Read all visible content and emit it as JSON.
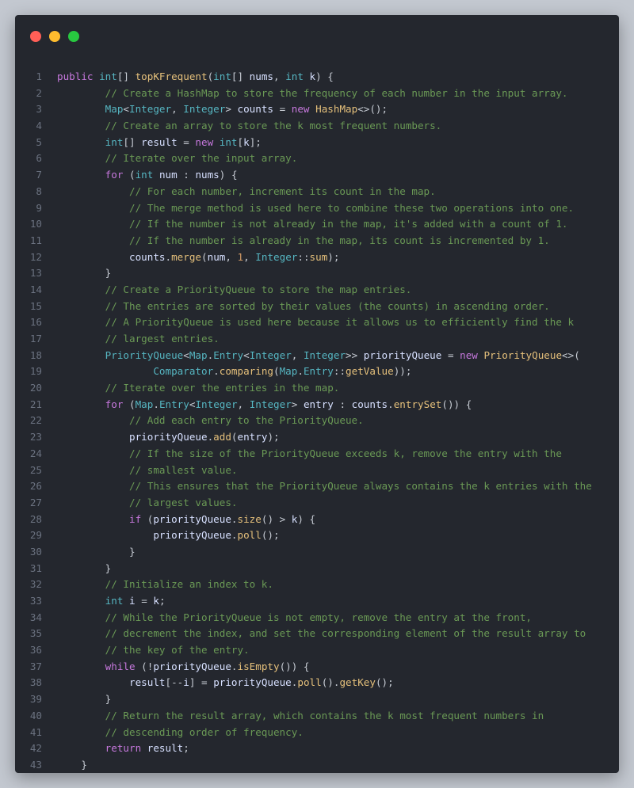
{
  "window": {
    "controls": [
      {
        "name": "close-dot",
        "color": "#ff5f57"
      },
      {
        "name": "minimize-dot",
        "color": "#febc2e"
      },
      {
        "name": "maximize-dot",
        "color": "#28c840"
      }
    ]
  },
  "editor": {
    "language": "java",
    "lines": [
      {
        "n": "1",
        "indent": 0,
        "tokens": [
          [
            "k",
            "public "
          ],
          [
            "ty",
            "int"
          ],
          [
            "p",
            "[] "
          ],
          [
            "f",
            "topKFrequent"
          ],
          [
            "p",
            "("
          ],
          [
            "ty",
            "int"
          ],
          [
            "p",
            "[] "
          ],
          [
            "v",
            "nums"
          ],
          [
            "p",
            ", "
          ],
          [
            "ty",
            "int"
          ],
          [
            "p",
            " "
          ],
          [
            "v",
            "k"
          ],
          [
            "p",
            ") {"
          ]
        ]
      },
      {
        "n": "2",
        "indent": 8,
        "tokens": [
          [
            "c",
            "// Create a HashMap to store the frequency of each number in the input array."
          ]
        ]
      },
      {
        "n": "3",
        "indent": 8,
        "tokens": [
          [
            "ty",
            "Map"
          ],
          [
            "p",
            "<"
          ],
          [
            "ty",
            "Integer"
          ],
          [
            "p",
            ", "
          ],
          [
            "ty",
            "Integer"
          ],
          [
            "p",
            "> "
          ],
          [
            "v",
            "counts"
          ],
          [
            "p",
            " = "
          ],
          [
            "k",
            "new "
          ],
          [
            "f",
            "HashMap"
          ],
          [
            "p",
            "<>();"
          ]
        ]
      },
      {
        "n": "4",
        "indent": 8,
        "tokens": [
          [
            "c",
            "// Create an array to store the k most frequent numbers."
          ]
        ]
      },
      {
        "n": "5",
        "indent": 8,
        "tokens": [
          [
            "ty",
            "int"
          ],
          [
            "p",
            "[] "
          ],
          [
            "v",
            "result"
          ],
          [
            "p",
            " = "
          ],
          [
            "k",
            "new "
          ],
          [
            "ty",
            "int"
          ],
          [
            "p",
            "["
          ],
          [
            "v",
            "k"
          ],
          [
            "p",
            "];"
          ]
        ]
      },
      {
        "n": "6",
        "indent": 8,
        "tokens": [
          [
            "c",
            "// Iterate over the input array."
          ]
        ]
      },
      {
        "n": "7",
        "indent": 8,
        "tokens": [
          [
            "k",
            "for"
          ],
          [
            "p",
            " ("
          ],
          [
            "ty",
            "int"
          ],
          [
            "p",
            " "
          ],
          [
            "v",
            "num"
          ],
          [
            "p",
            " : "
          ],
          [
            "v",
            "nums"
          ],
          [
            "p",
            ") {"
          ]
        ]
      },
      {
        "n": "8",
        "indent": 12,
        "tokens": [
          [
            "c",
            "// For each number, increment its count in the map."
          ]
        ]
      },
      {
        "n": "9",
        "indent": 12,
        "tokens": [
          [
            "c",
            "// The merge method is used here to combine these two operations into one."
          ]
        ]
      },
      {
        "n": "10",
        "indent": 12,
        "tokens": [
          [
            "c",
            "// If the number is not already in the map, it's added with a count of 1."
          ]
        ]
      },
      {
        "n": "11",
        "indent": 12,
        "tokens": [
          [
            "c",
            "// If the number is already in the map, its count is incremented by 1."
          ]
        ]
      },
      {
        "n": "12",
        "indent": 12,
        "tokens": [
          [
            "v",
            "counts"
          ],
          [
            "p",
            "."
          ],
          [
            "f",
            "merge"
          ],
          [
            "p",
            "("
          ],
          [
            "v",
            "num"
          ],
          [
            "p",
            ", "
          ],
          [
            "n",
            "1"
          ],
          [
            "p",
            ", "
          ],
          [
            "ty",
            "Integer"
          ],
          [
            "p",
            "::"
          ],
          [
            "f",
            "sum"
          ],
          [
            "p",
            ");"
          ]
        ]
      },
      {
        "n": "13",
        "indent": 8,
        "tokens": [
          [
            "p",
            "}"
          ]
        ]
      },
      {
        "n": "14",
        "indent": 8,
        "tokens": [
          [
            "c",
            "// Create a PriorityQueue to store the map entries."
          ]
        ]
      },
      {
        "n": "15",
        "indent": 8,
        "tokens": [
          [
            "c",
            "// The entries are sorted by their values (the counts) in ascending order."
          ]
        ]
      },
      {
        "n": "16",
        "indent": 8,
        "tokens": [
          [
            "c",
            "// A PriorityQueue is used here because it allows us to efficiently find the k"
          ]
        ]
      },
      {
        "n": "17",
        "indent": 8,
        "tokens": [
          [
            "c",
            "// largest entries."
          ]
        ]
      },
      {
        "n": "18",
        "indent": 8,
        "tokens": [
          [
            "ty",
            "PriorityQueue"
          ],
          [
            "p",
            "<"
          ],
          [
            "ty",
            "Map"
          ],
          [
            "p",
            "."
          ],
          [
            "ty",
            "Entry"
          ],
          [
            "p",
            "<"
          ],
          [
            "ty",
            "Integer"
          ],
          [
            "p",
            ", "
          ],
          [
            "ty",
            "Integer"
          ],
          [
            "p",
            ">> "
          ],
          [
            "v",
            "priorityQueue"
          ],
          [
            "p",
            " = "
          ],
          [
            "k",
            "new "
          ],
          [
            "f",
            "PriorityQueue"
          ],
          [
            "p",
            "<>("
          ]
        ]
      },
      {
        "n": "19",
        "indent": 16,
        "tokens": [
          [
            "ty",
            "Comparator"
          ],
          [
            "p",
            "."
          ],
          [
            "f",
            "comparing"
          ],
          [
            "p",
            "("
          ],
          [
            "ty",
            "Map"
          ],
          [
            "p",
            "."
          ],
          [
            "ty",
            "Entry"
          ],
          [
            "p",
            "::"
          ],
          [
            "f",
            "getValue"
          ],
          [
            "p",
            "));"
          ]
        ]
      },
      {
        "n": "20",
        "indent": 8,
        "tokens": [
          [
            "c",
            "// Iterate over the entries in the map."
          ]
        ]
      },
      {
        "n": "21",
        "indent": 8,
        "tokens": [
          [
            "k",
            "for"
          ],
          [
            "p",
            " ("
          ],
          [
            "ty",
            "Map"
          ],
          [
            "p",
            "."
          ],
          [
            "ty",
            "Entry"
          ],
          [
            "p",
            "<"
          ],
          [
            "ty",
            "Integer"
          ],
          [
            "p",
            ", "
          ],
          [
            "ty",
            "Integer"
          ],
          [
            "p",
            "> "
          ],
          [
            "v",
            "entry"
          ],
          [
            "p",
            " : "
          ],
          [
            "v",
            "counts"
          ],
          [
            "p",
            "."
          ],
          [
            "f",
            "entrySet"
          ],
          [
            "p",
            "()) {"
          ]
        ]
      },
      {
        "n": "22",
        "indent": 12,
        "tokens": [
          [
            "c",
            "// Add each entry to the PriorityQueue."
          ]
        ]
      },
      {
        "n": "23",
        "indent": 12,
        "tokens": [
          [
            "v",
            "priorityQueue"
          ],
          [
            "p",
            "."
          ],
          [
            "f",
            "add"
          ],
          [
            "p",
            "("
          ],
          [
            "v",
            "entry"
          ],
          [
            "p",
            ");"
          ]
        ]
      },
      {
        "n": "24",
        "indent": 12,
        "tokens": [
          [
            "c",
            "// If the size of the PriorityQueue exceeds k, remove the entry with the"
          ]
        ]
      },
      {
        "n": "25",
        "indent": 12,
        "tokens": [
          [
            "c",
            "// smallest value."
          ]
        ]
      },
      {
        "n": "26",
        "indent": 12,
        "tokens": [
          [
            "c",
            "// This ensures that the PriorityQueue always contains the k entries with the"
          ]
        ]
      },
      {
        "n": "27",
        "indent": 12,
        "tokens": [
          [
            "c",
            "// largest values."
          ]
        ]
      },
      {
        "n": "28",
        "indent": 12,
        "tokens": [
          [
            "k",
            "if"
          ],
          [
            "p",
            " ("
          ],
          [
            "v",
            "priorityQueue"
          ],
          [
            "p",
            "."
          ],
          [
            "f",
            "size"
          ],
          [
            "p",
            "() > "
          ],
          [
            "v",
            "k"
          ],
          [
            "p",
            ") {"
          ]
        ]
      },
      {
        "n": "29",
        "indent": 16,
        "tokens": [
          [
            "v",
            "priorityQueue"
          ],
          [
            "p",
            "."
          ],
          [
            "f",
            "poll"
          ],
          [
            "p",
            "();"
          ]
        ]
      },
      {
        "n": "30",
        "indent": 12,
        "tokens": [
          [
            "p",
            "}"
          ]
        ]
      },
      {
        "n": "31",
        "indent": 8,
        "tokens": [
          [
            "p",
            "}"
          ]
        ]
      },
      {
        "n": "32",
        "indent": 8,
        "tokens": [
          [
            "c",
            "// Initialize an index to k."
          ]
        ]
      },
      {
        "n": "33",
        "indent": 8,
        "tokens": [
          [
            "ty",
            "int"
          ],
          [
            "p",
            " "
          ],
          [
            "v",
            "i"
          ],
          [
            "p",
            " = "
          ],
          [
            "v",
            "k"
          ],
          [
            "p",
            ";"
          ]
        ]
      },
      {
        "n": "34",
        "indent": 8,
        "tokens": [
          [
            "c",
            "// While the PriorityQueue is not empty, remove the entry at the front,"
          ]
        ]
      },
      {
        "n": "35",
        "indent": 8,
        "tokens": [
          [
            "c",
            "// decrement the index, and set the corresponding element of the result array to"
          ]
        ]
      },
      {
        "n": "36",
        "indent": 8,
        "tokens": [
          [
            "c",
            "// the key of the entry."
          ]
        ]
      },
      {
        "n": "37",
        "indent": 8,
        "tokens": [
          [
            "k",
            "while"
          ],
          [
            "p",
            " (!"
          ],
          [
            "v",
            "priorityQueue"
          ],
          [
            "p",
            "."
          ],
          [
            "f",
            "isEmpty"
          ],
          [
            "p",
            "()) {"
          ]
        ]
      },
      {
        "n": "38",
        "indent": 12,
        "tokens": [
          [
            "v",
            "result"
          ],
          [
            "p",
            "[--"
          ],
          [
            "v",
            "i"
          ],
          [
            "p",
            "] = "
          ],
          [
            "v",
            "priorityQueue"
          ],
          [
            "p",
            "."
          ],
          [
            "f",
            "poll"
          ],
          [
            "p",
            "()."
          ],
          [
            "f",
            "getKey"
          ],
          [
            "p",
            "();"
          ]
        ]
      },
      {
        "n": "39",
        "indent": 8,
        "tokens": [
          [
            "p",
            "}"
          ]
        ]
      },
      {
        "n": "40",
        "indent": 8,
        "tokens": [
          [
            "c",
            "// Return the result array, which contains the k most frequent numbers in"
          ]
        ]
      },
      {
        "n": "41",
        "indent": 8,
        "tokens": [
          [
            "c",
            "// descending order of frequency."
          ]
        ]
      },
      {
        "n": "42",
        "indent": 8,
        "tokens": [
          [
            "k",
            "return "
          ],
          [
            "v",
            "result"
          ],
          [
            "p",
            ";"
          ]
        ]
      },
      {
        "n": "43",
        "indent": 4,
        "tokens": [
          [
            "p",
            "}"
          ]
        ]
      }
    ]
  }
}
